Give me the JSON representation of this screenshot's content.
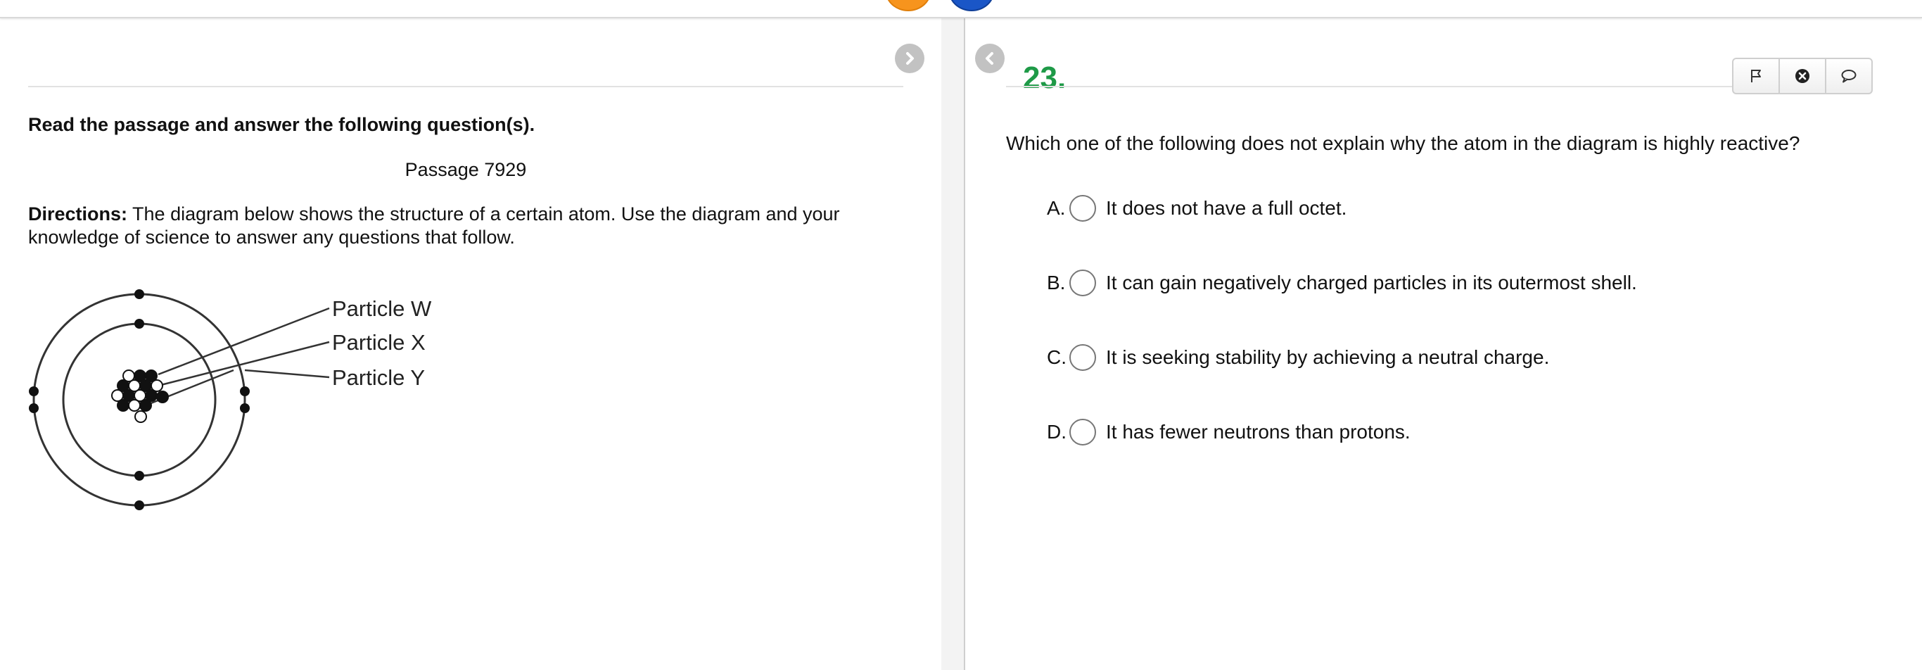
{
  "passage": {
    "instruction": "Read the passage and answer the following question(s).",
    "title": "Passage 7929",
    "directions_label": "Directions:",
    "directions_text": " The diagram below shows the structure of a certain atom. Use the diagram and your knowledge of science to answer any questions that follow.",
    "diagram_labels": [
      "Particle W",
      "Particle X",
      "Particle Y"
    ]
  },
  "question": {
    "number": "23.",
    "text": "Which one of the following does not explain why the atom in the diagram is highly reactive?",
    "choices": [
      {
        "letter": "A.",
        "text": "It does not have a full octet."
      },
      {
        "letter": "B.",
        "text": "It can gain negatively charged particles in its outermost shell."
      },
      {
        "letter": "C.",
        "text": "It is seeking stability by achieving a neutral charge."
      },
      {
        "letter": "D.",
        "text": "It has fewer neutrons than protons."
      }
    ]
  },
  "toolbar": {
    "icons": [
      "flag-icon",
      "close-circle-icon",
      "comment-icon"
    ]
  },
  "colors": {
    "question_number": "#1e9a47",
    "nav_circle": "#c2c2c2",
    "top_orange": "#f7941d",
    "top_blue": "#1a56c7"
  }
}
